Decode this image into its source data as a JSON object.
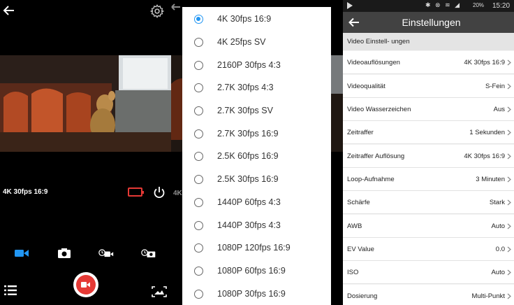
{
  "camera": {
    "resolution_label": "4K 30fps 16:9",
    "record_color": "#e53935",
    "active_mode_color": "#2196f3",
    "modes": [
      {
        "name": "video",
        "icon": "video-camera-icon",
        "active": true
      },
      {
        "name": "photo",
        "icon": "photo-camera-icon",
        "active": false
      },
      {
        "name": "timelapse-video",
        "icon": "timelapse-video-icon",
        "active": false
      },
      {
        "name": "timelapse-photo",
        "icon": "timelapse-photo-icon",
        "active": false
      }
    ]
  },
  "picker": {
    "accent": "#2196f3",
    "options": [
      {
        "label": "4K 30fps 16:9",
        "selected": true
      },
      {
        "label": "4K 25fps SV",
        "selected": false
      },
      {
        "label": "2160P 30fps 4:3",
        "selected": false
      },
      {
        "label": "2.7K 30fps 4:3",
        "selected": false
      },
      {
        "label": "2.7K 30fps SV",
        "selected": false
      },
      {
        "label": "2.7K 30fps 16:9",
        "selected": false
      },
      {
        "label": "2.5K 60fps 16:9",
        "selected": false
      },
      {
        "label": "2.5K 30fps 16:9",
        "selected": false
      },
      {
        "label": "1440P 60fps 4:3",
        "selected": false
      },
      {
        "label": "1440P 30fps 4:3",
        "selected": false
      },
      {
        "label": "1080P 120fps 16:9",
        "selected": false
      },
      {
        "label": "1080P 60fps 16:9",
        "selected": false
      },
      {
        "label": "1080P 30fps 16:9",
        "selected": false
      }
    ]
  },
  "settings": {
    "status": {
      "battery": "20%",
      "time": "15:20"
    },
    "title": "Einstellungen",
    "section": "Video Einstell- ungen",
    "appbar_color": "#424242",
    "rows": [
      {
        "key": "Videoauflösungen",
        "value": "4K 30fps 16:9"
      },
      {
        "key": "Videoqualität",
        "value": "S-Fein"
      },
      {
        "key": "Video Wasserzeichen",
        "value": "Aus"
      },
      {
        "key": "Zeitraffer",
        "value": "1 Sekunden"
      },
      {
        "key": "Zeitraffer Auflösung",
        "value": "4K 30fps 16:9"
      },
      {
        "key": "Loop-Aufnahme",
        "value": "3 Minuten"
      },
      {
        "key": "Schärfe",
        "value": "Stark"
      },
      {
        "key": "AWB",
        "value": "Auto"
      },
      {
        "key": "EV Value",
        "value": "0.0"
      },
      {
        "key": "ISO",
        "value": "Auto"
      },
      {
        "key": "Dosierung",
        "value": "Multi-Punkt"
      }
    ]
  }
}
